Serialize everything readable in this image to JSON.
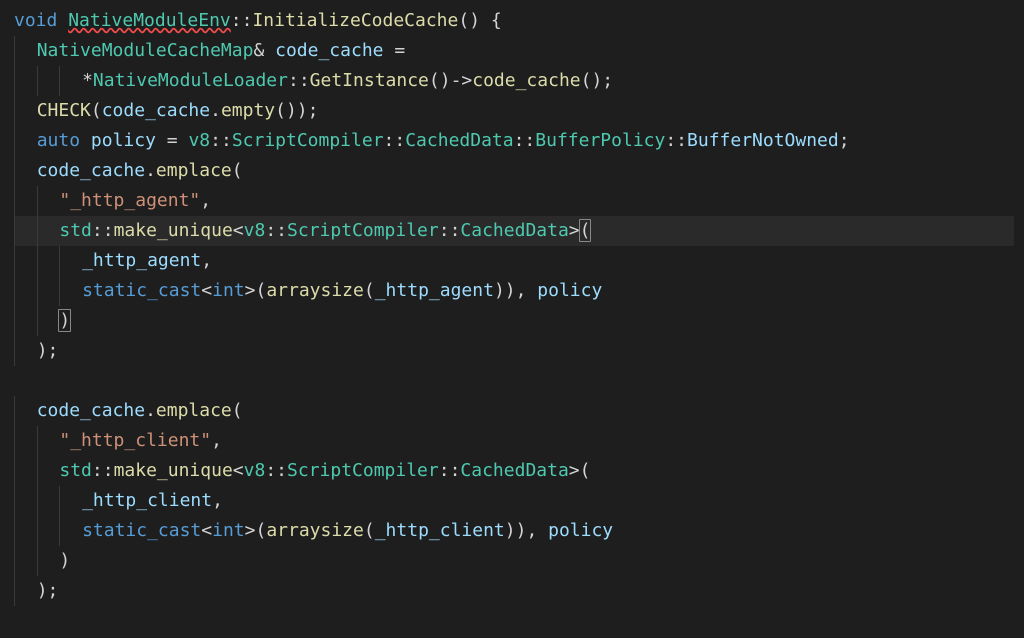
{
  "editor": {
    "fontFamily": "Menlo, Consolas, Monaco, monospace",
    "fontSize": 18,
    "lineHeight": 30,
    "background": "#1e1e1e",
    "foreground": "#d4d4d4",
    "highlightLineBg": "#2a2a2a"
  },
  "syntax_colors": {
    "keyword": "#569cd6",
    "type": "#4ec9b0",
    "function": "#dcdcaa",
    "variable": "#9cdcfe",
    "string": "#ce9178"
  },
  "code": {
    "lines": [
      {
        "indent": 0,
        "hl": false,
        "tokens": [
          [
            "kw",
            "void"
          ],
          [
            "punc",
            " "
          ],
          [
            "type squiggle",
            "NativeModuleEnv"
          ],
          [
            "punc",
            "::"
          ],
          [
            "func",
            "InitializeCodeCache"
          ],
          [
            "punc",
            "() {"
          ]
        ]
      },
      {
        "indent": 1,
        "hl": false,
        "tokens": [
          [
            "type",
            "NativeModuleCacheMap"
          ],
          [
            "punc",
            "& "
          ],
          [
            "var",
            "code_cache"
          ],
          [
            "punc",
            " ="
          ]
        ]
      },
      {
        "indent": 3,
        "hl": false,
        "tokens": [
          [
            "punc",
            "*"
          ],
          [
            "type",
            "NativeModuleLoader"
          ],
          [
            "punc",
            "::"
          ],
          [
            "func",
            "GetInstance"
          ],
          [
            "punc",
            "()->"
          ],
          [
            "func",
            "code_cache"
          ],
          [
            "punc",
            "();"
          ]
        ]
      },
      {
        "indent": 1,
        "hl": false,
        "tokens": [
          [
            "func",
            "CHECK"
          ],
          [
            "punc",
            "("
          ],
          [
            "var",
            "code_cache"
          ],
          [
            "punc",
            "."
          ],
          [
            "func",
            "empty"
          ],
          [
            "punc",
            "());"
          ]
        ]
      },
      {
        "indent": 1,
        "hl": false,
        "tokens": [
          [
            "kw",
            "auto"
          ],
          [
            "punc",
            " "
          ],
          [
            "var",
            "policy"
          ],
          [
            "punc",
            " = "
          ],
          [
            "type",
            "v8"
          ],
          [
            "punc",
            "::"
          ],
          [
            "type",
            "ScriptCompiler"
          ],
          [
            "punc",
            "::"
          ],
          [
            "type",
            "CachedData"
          ],
          [
            "punc",
            "::"
          ],
          [
            "type",
            "BufferPolicy"
          ],
          [
            "punc",
            "::"
          ],
          [
            "var",
            "BufferNotOwned"
          ],
          [
            "punc",
            ";"
          ]
        ]
      },
      {
        "indent": 1,
        "hl": false,
        "tokens": [
          [
            "var",
            "code_cache"
          ],
          [
            "punc",
            "."
          ],
          [
            "func",
            "emplace"
          ],
          [
            "punc",
            "("
          ]
        ]
      },
      {
        "indent": 2,
        "hl": false,
        "tokens": [
          [
            "str",
            "\"_http_agent\""
          ],
          [
            "punc",
            ","
          ]
        ]
      },
      {
        "indent": 2,
        "hl": true,
        "tokens": [
          [
            "type",
            "std"
          ],
          [
            "punc",
            "::"
          ],
          [
            "func",
            "make_unique"
          ],
          [
            "punc",
            "<"
          ],
          [
            "type",
            "v8"
          ],
          [
            "punc",
            "::"
          ],
          [
            "type",
            "ScriptCompiler"
          ],
          [
            "punc",
            "::"
          ],
          [
            "type",
            "CachedData"
          ],
          [
            "punc",
            ">"
          ],
          [
            "punc bracket-match",
            "("
          ]
        ]
      },
      {
        "indent": 3,
        "hl": false,
        "tokens": [
          [
            "var",
            "_http_agent"
          ],
          [
            "punc",
            ","
          ]
        ]
      },
      {
        "indent": 3,
        "hl": false,
        "tokens": [
          [
            "kw",
            "static_cast"
          ],
          [
            "punc",
            "<"
          ],
          [
            "kw",
            "int"
          ],
          [
            "punc",
            ">("
          ],
          [
            "func",
            "arraysize"
          ],
          [
            "punc",
            "("
          ],
          [
            "var",
            "_http_agent"
          ],
          [
            "punc",
            ")), "
          ],
          [
            "var",
            "policy"
          ]
        ]
      },
      {
        "indent": 2,
        "hl": false,
        "tokens": [
          [
            "punc bracket-match",
            ")"
          ]
        ]
      },
      {
        "indent": 1,
        "hl": false,
        "tokens": [
          [
            "punc",
            ");"
          ]
        ]
      },
      {
        "indent": 0,
        "hl": false,
        "tokens": []
      },
      {
        "indent": 1,
        "hl": false,
        "tokens": [
          [
            "var",
            "code_cache"
          ],
          [
            "punc",
            "."
          ],
          [
            "func",
            "emplace"
          ],
          [
            "punc",
            "("
          ]
        ]
      },
      {
        "indent": 2,
        "hl": false,
        "tokens": [
          [
            "str",
            "\"_http_client\""
          ],
          [
            "punc",
            ","
          ]
        ]
      },
      {
        "indent": 2,
        "hl": false,
        "tokens": [
          [
            "type",
            "std"
          ],
          [
            "punc",
            "::"
          ],
          [
            "func",
            "make_unique"
          ],
          [
            "punc",
            "<"
          ],
          [
            "type",
            "v8"
          ],
          [
            "punc",
            "::"
          ],
          [
            "type",
            "ScriptCompiler"
          ],
          [
            "punc",
            "::"
          ],
          [
            "type",
            "CachedData"
          ],
          [
            "punc",
            ">("
          ]
        ]
      },
      {
        "indent": 3,
        "hl": false,
        "tokens": [
          [
            "var",
            "_http_client"
          ],
          [
            "punc",
            ","
          ]
        ]
      },
      {
        "indent": 3,
        "hl": false,
        "tokens": [
          [
            "kw",
            "static_cast"
          ],
          [
            "punc",
            "<"
          ],
          [
            "kw",
            "int"
          ],
          [
            "punc",
            ">("
          ],
          [
            "func",
            "arraysize"
          ],
          [
            "punc",
            "("
          ],
          [
            "var",
            "_http_client"
          ],
          [
            "punc",
            ")), "
          ],
          [
            "var",
            "policy"
          ]
        ]
      },
      {
        "indent": 2,
        "hl": false,
        "tokens": [
          [
            "punc",
            ")"
          ]
        ]
      },
      {
        "indent": 1,
        "hl": false,
        "tokens": [
          [
            "punc",
            ");"
          ]
        ]
      }
    ]
  }
}
